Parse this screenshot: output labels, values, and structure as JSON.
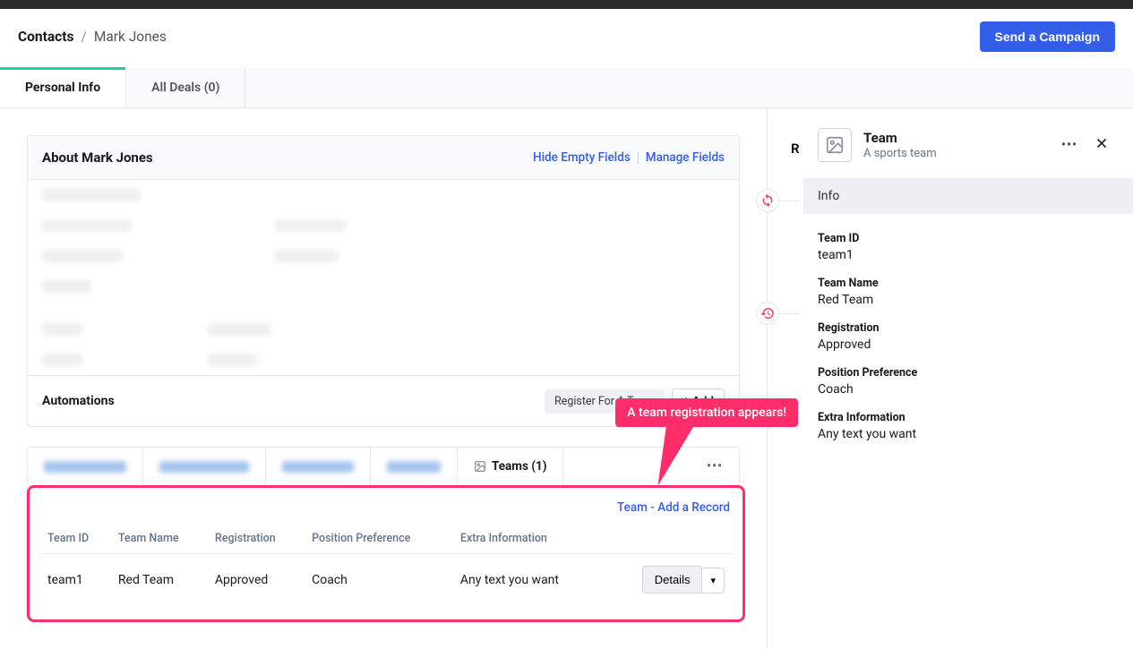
{
  "breadcrumb": {
    "root": "Contacts",
    "leaf": "Mark Jones"
  },
  "header": {
    "send_campaign": "Send a Campaign"
  },
  "tabs": {
    "personal": "Personal Info",
    "deals": "All Deals (0)"
  },
  "about": {
    "title": "About Mark Jones",
    "hide_fields": "Hide Empty Fields",
    "manage_fields": "Manage Fields",
    "automations_label": "Automations",
    "register_pill": "Register For A Team",
    "add_button": "+ Add"
  },
  "sub_tabs": {
    "teams": "Teams (1)"
  },
  "teams_table": {
    "add_record": "Team - Add a Record",
    "headers": {
      "team_id": "Team ID",
      "team_name": "Team Name",
      "registration": "Registration",
      "position_pref": "Position Preference",
      "extra_info": "Extra Information"
    },
    "row": {
      "team_id": "team1",
      "team_name": "Red Team",
      "registration": "Approved",
      "position_pref": "Coach",
      "extra_info": "Any text you want"
    },
    "details_button": "Details"
  },
  "callout": "A team registration appears!",
  "right_cutoff": "R",
  "panel": {
    "title": "Team",
    "subtitle": "A sports team",
    "info_tab": "Info",
    "fields": {
      "team_id_label": "Team ID",
      "team_id_value": "team1",
      "team_name_label": "Team Name",
      "team_name_value": "Red Team",
      "registration_label": "Registration",
      "registration_value": "Approved",
      "position_label": "Position Preference",
      "position_value": "Coach",
      "extra_label": "Extra Information",
      "extra_value": "Any text you want"
    }
  }
}
